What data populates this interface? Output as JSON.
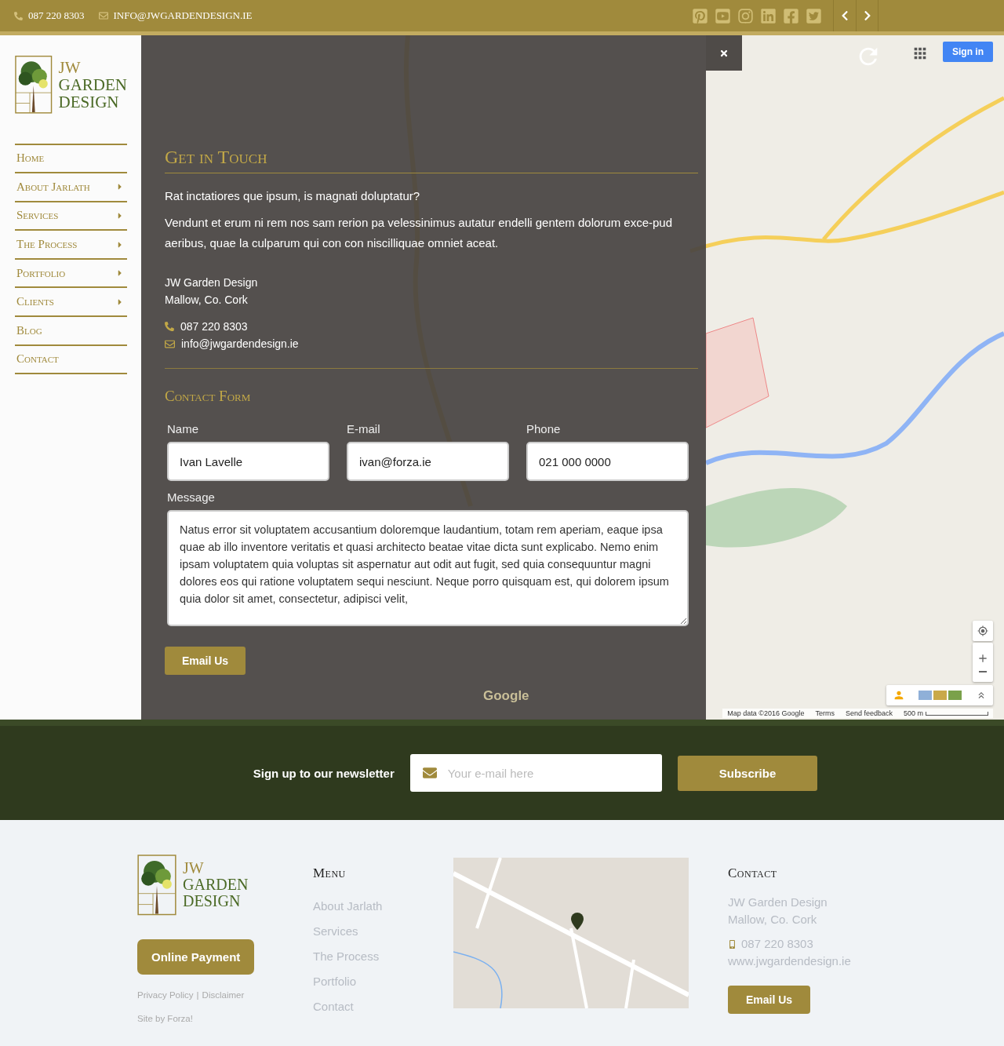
{
  "topbar": {
    "phone": "087 220 8303",
    "email": "INFO@JWGARDENDESIGN.IE"
  },
  "sidebar": {
    "logo": [
      "JW",
      "GARDEN",
      "DESIGN"
    ],
    "menu": [
      {
        "label": "Home",
        "has_submenu": false
      },
      {
        "label": "About Jarlath",
        "has_submenu": true
      },
      {
        "label": "Services",
        "has_submenu": true
      },
      {
        "label": "The Process",
        "has_submenu": true
      },
      {
        "label": "Portfolio",
        "has_submenu": true
      },
      {
        "label": "Clients",
        "has_submenu": true
      },
      {
        "label": "Blog",
        "has_submenu": false
      },
      {
        "label": "Contact",
        "has_submenu": false
      }
    ]
  },
  "contact": {
    "title": "Get in Touch",
    "intro": "Rat inctatiores que ipsum, is magnati doluptatur?",
    "body": "Vendunt et erum ni rem nos sam rerion pa velessinimus autatur endelli gentem dolorum exce-pud aeribus, quae la culparum qui con con niscilliquae omniet aceat.",
    "company": "JW Garden Design",
    "address": "Mallow, Co. Cork",
    "phone": "087 220 8303",
    "email": "info@jwgardendesign.ie",
    "form_title": "Contact Form",
    "fields": [
      {
        "label": "Name",
        "value": "Ivan Lavelle"
      },
      {
        "label": "E-mail",
        "value": "ivan@forza.ie"
      },
      {
        "label": "Phone",
        "value": "021 000 0000"
      }
    ],
    "message": {
      "label": "Message",
      "value": "Natus error sit voluptatem accusantium doloremque laudantium, totam rem aperiam, eaque ipsa quae ab illo inventore veritatis et quasi architecto beatae vitae dicta sunt explicabo. Nemo enim ipsam voluptatem quia voluptas sit aspernatur aut odit aut fugit, sed quia consequuntur magni dolores eos qui ratione voluptatem sequi nesciunt. Neque porro quisquam est, qui dolorem ipsum quia dolor sit amet, consectetur, adipisci velit,"
    },
    "submit": "Email Us"
  },
  "map": {
    "sign_in": "Sign in",
    "logo": "Google",
    "attribution": [
      "Map data ©2016 Google",
      "Terms",
      "Send feedback"
    ],
    "scale": "500 m"
  },
  "newsletter": {
    "label": "Sign up to our newsletter",
    "placeholder": "Your e-mail here",
    "button": "Subscribe"
  },
  "footer": {
    "logo": [
      "JW",
      "GARDEN",
      "DESIGN"
    ],
    "payment_button": "Online Payment",
    "legal_links": [
      "Privacy Policy",
      "Disclaimer"
    ],
    "separator": "|",
    "credit": "Site by Forza!",
    "menu": {
      "title": "Menu",
      "items": [
        "About Jarlath",
        "Services",
        "The Process",
        "Portfolio",
        "Contact"
      ]
    },
    "contact": {
      "title": "Contact",
      "company": "JW Garden Design",
      "address": "Mallow, Co. Cork",
      "phone": "087 220 8303",
      "website": "www.jwgardendesign.ie",
      "button": "Email Us"
    }
  }
}
